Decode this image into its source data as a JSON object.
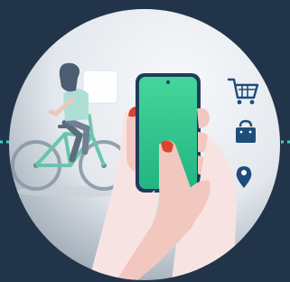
{
  "illustration": {
    "icons": [
      "shopping-cart-icon",
      "shopping-bag-icon",
      "location-pin-icon"
    ],
    "colors": {
      "background": "#22344a",
      "circle_light": "#f4f6f8",
      "circle_dark": "#8d9aa7",
      "phone_screen_top": "#3fd19a",
      "phone_screen_bottom": "#1fb27f",
      "phone_frame": "#1f3b5a",
      "dotted_line": "#3fd3c0",
      "skin": "#f2c7c0",
      "sleeve": "#f7e4e2",
      "nails": "#d9452f",
      "icon_blue": "#1f4d7a",
      "bike_frame": "#5fc3a8",
      "rider_shirt": "#a9ddd3",
      "rider_hair": "#3f5166",
      "delivery_box": "#ffffff"
    }
  }
}
